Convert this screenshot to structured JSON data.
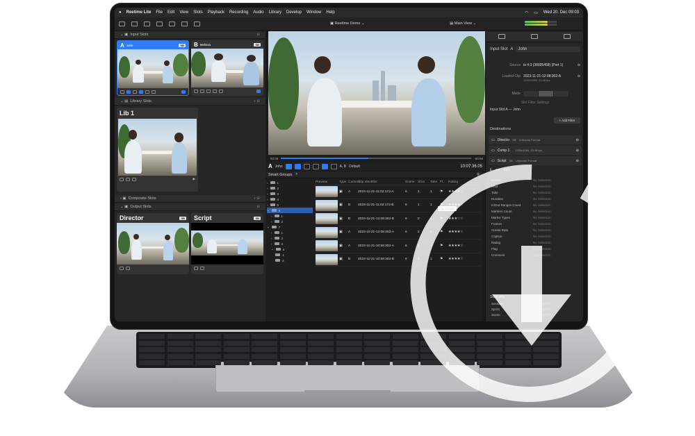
{
  "menubar": {
    "app": "Reetime Lite",
    "items": [
      "File",
      "Edit",
      "View",
      "Slots",
      "Playback",
      "Recording",
      "Audio",
      "Library",
      "Develop",
      "Window",
      "Help"
    ],
    "clock": "Wed 20. Dec 09:03"
  },
  "toolbar": {
    "project": "Reetime Demo",
    "view": "Main View"
  },
  "left": {
    "input_slots_title": "Input Slots",
    "slot_a": {
      "letter": "A",
      "name": "John",
      "badge": "SB"
    },
    "slot_b": {
      "letter": "B",
      "name": "Melissa",
      "badge": "SB"
    },
    "library_slots_title": "Library Slots",
    "lib1": {
      "name": "Lib 1"
    },
    "composite_slots_title": "Composite Slots",
    "output_slots_title": "Output Slots",
    "out_director": {
      "name": "Director",
      "badge": "SB"
    },
    "out_script": {
      "name": "Script",
      "badge": "SB"
    }
  },
  "scrub": {
    "start": "00:08",
    "end": "-00:06"
  },
  "transport": {
    "slot_letter": "A",
    "slot_name": "John",
    "cams": "A, B",
    "preset": "Default",
    "timecode": "10:07:36.05"
  },
  "browser": {
    "title": "Smart Groups",
    "tooltip": "Clip Identifier",
    "columns": [
      "Preview",
      "Type",
      "Camera",
      "Clip Identifier",
      "Scene",
      "Shot",
      "Take",
      "Fl..",
      "Rating"
    ],
    "rows": [
      {
        "cam": "A",
        "id": "2023-11-21-11:02:172-A",
        "scene": "6",
        "shot": "1",
        "take": "1",
        "rating": "★★★★☆"
      },
      {
        "cam": "B",
        "id": "2023-11-21-11:02:172-B",
        "scene": "6",
        "shot": "1",
        "take": "1",
        "rating": "★★★★☆"
      },
      {
        "cam": "B",
        "id": "2023-11-21-12:08:302-B",
        "scene": "6",
        "shot": "2",
        "take": "1",
        "rating": "★★★☆☆"
      },
      {
        "cam": "A",
        "id": "2023-11-21-12:08:302-A",
        "scene": "6",
        "shot": "2",
        "take": "1",
        "rating": "★★★★☆"
      },
      {
        "cam": "A",
        "id": "2023-11-21-10:59:302-A",
        "scene": "6",
        "shot": "1",
        "take": "1",
        "rating": "★★★★☆"
      },
      {
        "cam": "B",
        "id": "2023-11-21-10:59:302-B",
        "scene": "6",
        "shot": "1",
        "take": "1",
        "rating": "★★★★☆"
      }
    ]
  },
  "inspector": {
    "input_slot_label": "Input Slot",
    "input_slot_letter": "A",
    "input_slot_name": "John",
    "source_label": "Source",
    "source_value": "io 4.3 (30005458) (Port 1)",
    "loaded_clip_label": "Loaded Clip",
    "loaded_clip_value": "2023-11-21-12:08:302-A",
    "loaded_clip_sub": "1920x1080, 23.98 fps",
    "mode_label": "Mode",
    "slot_filter_settings": "Slot Filter Settings",
    "filter_line": "Input Slot A — John",
    "add_filter": "+ Add Filter",
    "destinations_title": "Destinations",
    "destinations": [
      {
        "name": "Director",
        "badge": "SB",
        "format": "Unknown Format"
      },
      {
        "name": "Comp 1",
        "badge": "",
        "format": "1920x1080, 23.98 fps"
      },
      {
        "name": "Script",
        "badge": "SB",
        "format": "Unknown Format"
      }
    ],
    "info_tab": "Info",
    "no_selection": "No Selection",
    "clip_fields": [
      "Scene",
      "Shot",
      "Take",
      "Duration",
      "In/Out Ranges Count",
      "Markers Count",
      "Marker Types",
      "Frames",
      "Create Date",
      "Caption",
      "Rating",
      "Flag",
      "Comment"
    ],
    "state_info": "State Info",
    "state_fields": [
      "Session",
      "Sprint",
      "Scene"
    ]
  },
  "colors": {
    "accent": "#2f7cf6",
    "app_bg": "#1b1b1b"
  }
}
